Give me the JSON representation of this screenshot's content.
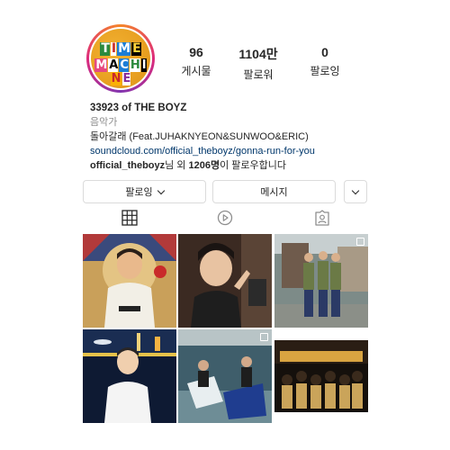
{
  "profile": {
    "avatar_lines": [
      "TIME",
      "MACHINE"
    ],
    "display_name": "33923 of THE BOYZ",
    "category": "음악가",
    "bio_line": "돌아갈래 (Feat.JUHAKNYEON&SUNWOO&ERIC)",
    "link": "soundcloud.com/official_theboyz/gonna-run-for-you",
    "followed_by_user": "official_theboyz",
    "followed_by_suffix_1": "님 외 ",
    "followed_by_count": "1206명",
    "followed_by_suffix_2": "이 팔로우합니다"
  },
  "stats": [
    {
      "value": "96",
      "label": "게시물"
    },
    {
      "value": "1104만",
      "label": "팔로워"
    },
    {
      "value": "0",
      "label": "팔로잉"
    }
  ],
  "actions": {
    "follow_label": "팔로잉",
    "message_label": "메시지"
  },
  "tabs": [
    "grid-icon",
    "reels-icon",
    "tagged-icon"
  ],
  "colors": {
    "link": "#00376b",
    "border": "#dbdbdb",
    "muted": "#8e8e8e",
    "text": "#262626"
  }
}
